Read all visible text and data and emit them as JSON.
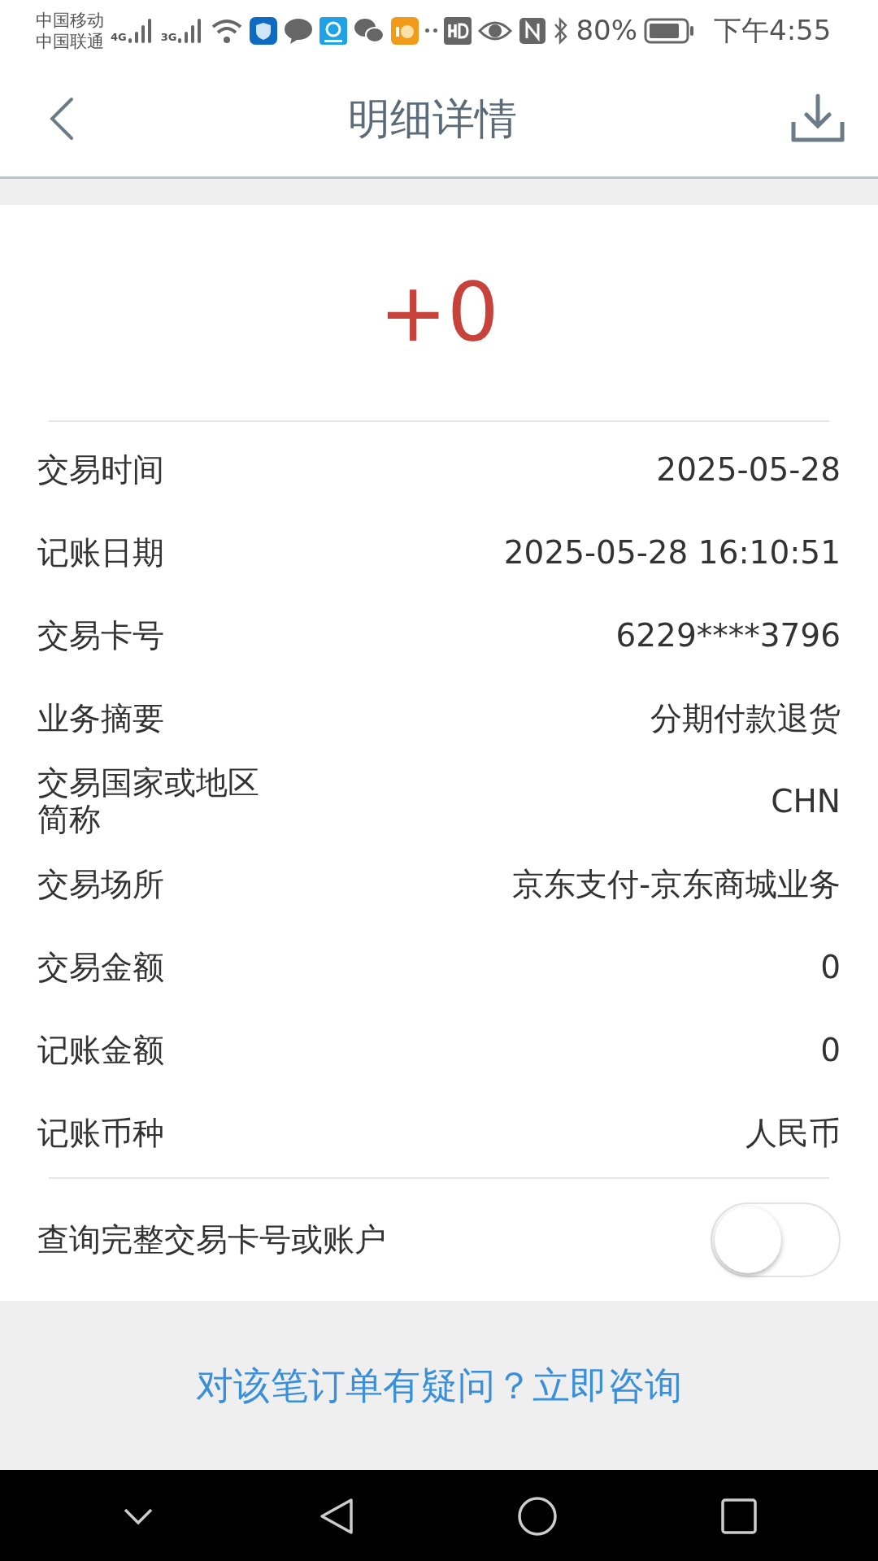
{
  "status_bar": {
    "carriers": [
      "中国移动",
      "中国联通"
    ],
    "network_labels": [
      "4G",
      "3G"
    ],
    "battery": "80%",
    "time": "下午4:55"
  },
  "header": {
    "title": "明细详情"
  },
  "amount": "+0",
  "details": [
    {
      "label": "交易时间",
      "value": "2025-05-28"
    },
    {
      "label": "记账日期",
      "value": "2025-05-28 16:10:51"
    },
    {
      "label": "交易卡号",
      "value": "6229****3796"
    },
    {
      "label": "业务摘要",
      "value": "分期付款退货"
    },
    {
      "label": "交易国家或地区简称",
      "value": "CHN"
    },
    {
      "label": "交易场所",
      "value": "京东支付-京东商城业务"
    },
    {
      "label": "交易金额",
      "value": "0"
    },
    {
      "label": "记账金额",
      "value": "0"
    },
    {
      "label": "记账币种",
      "value": "人民币"
    }
  ],
  "toggle": {
    "label": "查询完整交易卡号或账户",
    "on": false
  },
  "help_link": "对该笔订单有疑问？立即咨询"
}
